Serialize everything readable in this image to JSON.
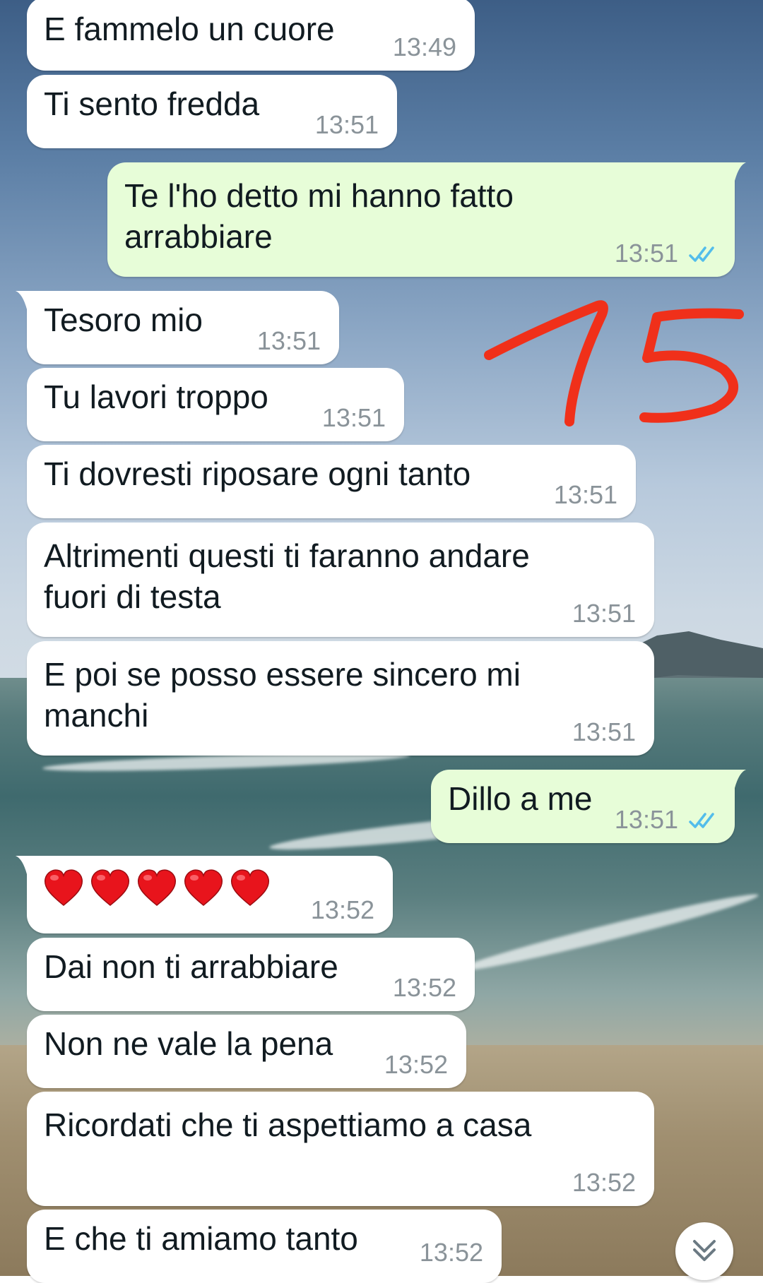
{
  "annotation": {
    "text": "15",
    "color": "#f0301a"
  },
  "messages": [
    {
      "text": "E fammelo un cuore",
      "time": "13:49",
      "direction": "in"
    },
    {
      "text": "Ti sento fredda",
      "time": "13:51",
      "direction": "in"
    },
    {
      "line1": "Te l'ho detto mi hanno fatto",
      "line2": "arrabbiare",
      "time": "13:51",
      "direction": "out",
      "status": "read"
    },
    {
      "text": "Tesoro mio",
      "time": "13:51",
      "direction": "in"
    },
    {
      "text": "Tu lavori troppo",
      "time": "13:51",
      "direction": "in"
    },
    {
      "text": "Ti dovresti riposare ogni tanto",
      "time": "13:51",
      "direction": "in"
    },
    {
      "line1": "Altrimenti questi ti faranno andare",
      "line2": "fuori di testa",
      "time": "13:51",
      "direction": "in"
    },
    {
      "line1": "E poi se posso essere sincero mi",
      "line2": "manchi",
      "time": "13:51",
      "direction": "in"
    },
    {
      "text": "Dillo a me",
      "time": "13:51",
      "direction": "out",
      "status": "read"
    },
    {
      "emoji": "❤️❤️❤️❤️❤️",
      "emoji_count": 5,
      "time": "13:52",
      "direction": "in"
    },
    {
      "text": "Dai non ti arrabbiare",
      "time": "13:52",
      "direction": "in"
    },
    {
      "text": "Non ne vale la pena",
      "time": "13:52",
      "direction": "in"
    },
    {
      "text": "Ricordati che ti aspettiamo a casa",
      "time": "13:52",
      "direction": "in"
    },
    {
      "text": "E che ti amiamo tanto",
      "time": "13:52",
      "direction": "in"
    }
  ],
  "icons": {
    "read_receipt": "double-check-icon",
    "scroll_down": "chevron-double-down-icon"
  },
  "colors": {
    "incoming_bubble": "#ffffff",
    "outgoing_bubble": "#e7fdd8",
    "read_tick": "#53bdeb",
    "timestamp": "#8a9399"
  }
}
